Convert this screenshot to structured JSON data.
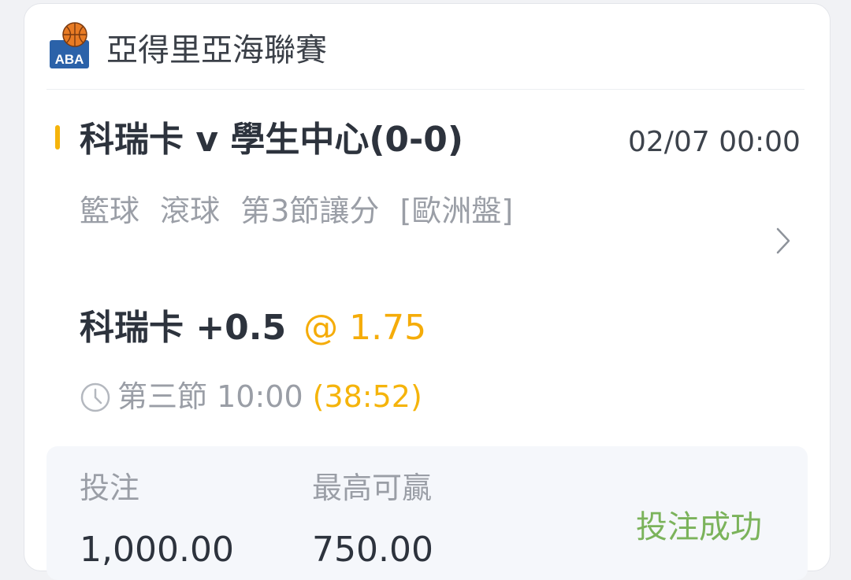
{
  "league": {
    "logo_text": "ABA",
    "name": "亞得里亞海聯賽"
  },
  "match": {
    "title": "科瑞卡 v 學生中心(0-0)",
    "time": "02/07 00:00"
  },
  "bet": {
    "sport": "籃球",
    "type": "滾球",
    "market": "第3節讓分",
    "odds_format": "[歐洲盤]",
    "selection": "科瑞卡 +0.5",
    "odds": "@ 1.75"
  },
  "game_clock": {
    "period": "第三節",
    "clock": "10:00",
    "elapsed": "(38:52)"
  },
  "summary": {
    "stake_label": "投注",
    "stake_value": "1,000.00",
    "max_win_label": "最高可贏",
    "max_win_value": "750.00",
    "status": "投注成功"
  },
  "colors": {
    "accent": "#f5b40b",
    "odds": "#f5ac09",
    "success": "#7bb35b",
    "logo_blue": "#2b62a9",
    "basketball_orange": "#e87b24"
  },
  "icons": [
    "basketball-logo-icon",
    "chevron-right-icon",
    "clock-icon"
  ]
}
